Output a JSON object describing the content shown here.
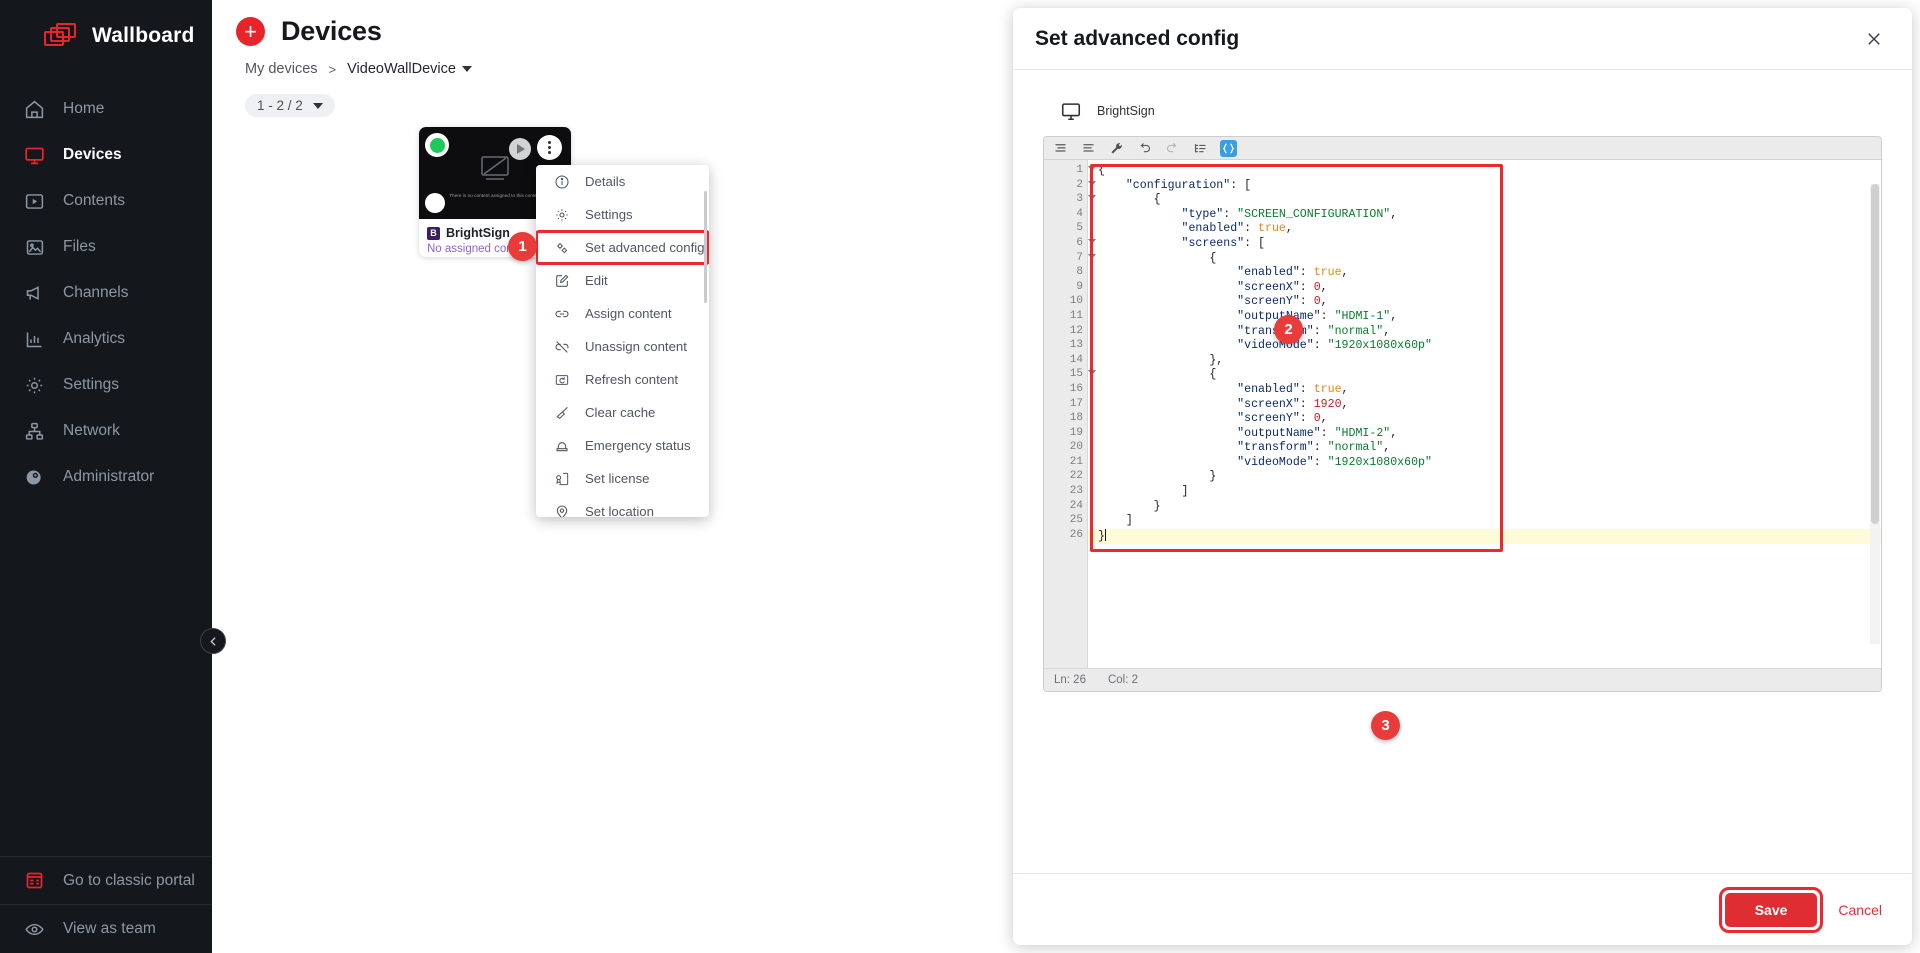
{
  "sidebar": {
    "brand": "Wallboard",
    "items": [
      {
        "label": "Home",
        "icon": "home-icon"
      },
      {
        "label": "Devices",
        "icon": "monitor-icon",
        "active": true
      },
      {
        "label": "Contents",
        "icon": "play-box-icon"
      },
      {
        "label": "Files",
        "icon": "image-icon"
      },
      {
        "label": "Channels",
        "icon": "megaphone-icon"
      },
      {
        "label": "Analytics",
        "icon": "bar-chart-icon"
      },
      {
        "label": "Settings",
        "icon": "gear-icon"
      },
      {
        "label": "Network",
        "icon": "network-icon"
      },
      {
        "label": "Administrator",
        "icon": "admin-icon"
      }
    ],
    "bottom": [
      {
        "label": "Go to classic portal",
        "icon": "classic-portal-icon"
      },
      {
        "label": "View as team",
        "icon": "eye-icon"
      }
    ],
    "collapse_icon": "chevron-left-icon"
  },
  "page": {
    "title": "Devices",
    "add_label": "+",
    "breadcrumb": {
      "root": "My devices",
      "separator": ">",
      "current": "VideoWallDevice"
    },
    "pager_label": "1 - 2 / 2"
  },
  "device_card": {
    "name": "BrightSign",
    "badge": "B",
    "status": "No assigned content",
    "thumb_message": "There is no content assigned to this content",
    "status_dot_color": "#1ec85a"
  },
  "context_menu": {
    "items": [
      {
        "label": "Details",
        "icon": "info-icon"
      },
      {
        "label": "Settings",
        "icon": "gear-icon"
      },
      {
        "label": "Set advanced config",
        "icon": "advanced-config-icon",
        "highlighted": true
      },
      {
        "label": "Edit",
        "icon": "edit-icon"
      },
      {
        "label": "Assign content",
        "icon": "link-icon"
      },
      {
        "label": "Unassign content",
        "icon": "unlink-icon"
      },
      {
        "label": "Refresh content",
        "icon": "refresh-icon"
      },
      {
        "label": "Clear cache",
        "icon": "broom-icon"
      },
      {
        "label": "Emergency status",
        "icon": "siren-icon"
      },
      {
        "label": "Set license",
        "icon": "license-icon"
      },
      {
        "label": "Set location",
        "icon": "location-icon"
      }
    ]
  },
  "annotations": [
    {
      "number": "1"
    },
    {
      "number": "2"
    },
    {
      "number": "3"
    }
  ],
  "modal": {
    "title": "Set advanced config",
    "close_icon": "close-icon",
    "device_name": "BrightSign",
    "device_icon": "monitor-icon",
    "toolbar": [
      {
        "icon": "compact-json-icon"
      },
      {
        "icon": "format-json-icon"
      },
      {
        "icon": "repair-wrench-icon"
      },
      {
        "icon": "undo-icon"
      },
      {
        "icon": "redo-icon",
        "disabled": true
      },
      {
        "icon": "tree-view-icon"
      },
      {
        "icon": "code-view-icon",
        "active": true
      }
    ],
    "editor": {
      "lines": [
        {
          "n": 1,
          "fold": true,
          "text": "{"
        },
        {
          "n": 2,
          "fold": true,
          "text": "    \"configuration\": ["
        },
        {
          "n": 3,
          "fold": true,
          "text": "        {"
        },
        {
          "n": 4,
          "fold": false,
          "text": "            \"type\": \"SCREEN_CONFIGURATION\","
        },
        {
          "n": 5,
          "fold": false,
          "text": "            \"enabled\": true,"
        },
        {
          "n": 6,
          "fold": true,
          "text": "            \"screens\": ["
        },
        {
          "n": 7,
          "fold": true,
          "text": "                {"
        },
        {
          "n": 8,
          "fold": false,
          "text": "                    \"enabled\": true,"
        },
        {
          "n": 9,
          "fold": false,
          "text": "                    \"screenX\": 0,"
        },
        {
          "n": 10,
          "fold": false,
          "text": "                    \"screenY\": 0,"
        },
        {
          "n": 11,
          "fold": false,
          "text": "                    \"outputName\": \"HDMI-1\","
        },
        {
          "n": 12,
          "fold": false,
          "text": "                    \"transform\": \"normal\","
        },
        {
          "n": 13,
          "fold": false,
          "text": "                    \"videoMode\": \"1920x1080x60p\""
        },
        {
          "n": 14,
          "fold": false,
          "text": "                },"
        },
        {
          "n": 15,
          "fold": true,
          "text": "                {"
        },
        {
          "n": 16,
          "fold": false,
          "text": "                    \"enabled\": true,"
        },
        {
          "n": 17,
          "fold": false,
          "text": "                    \"screenX\": 1920,"
        },
        {
          "n": 18,
          "fold": false,
          "text": "                    \"screenY\": 0,"
        },
        {
          "n": 19,
          "fold": false,
          "text": "                    \"outputName\": \"HDMI-2\","
        },
        {
          "n": 20,
          "fold": false,
          "text": "                    \"transform\": \"normal\","
        },
        {
          "n": 21,
          "fold": false,
          "text": "                    \"videoMode\": \"1920x1080x60p\""
        },
        {
          "n": 22,
          "fold": false,
          "text": "                }"
        },
        {
          "n": 23,
          "fold": false,
          "text": "            ]"
        },
        {
          "n": 24,
          "fold": false,
          "text": "        }"
        },
        {
          "n": 25,
          "fold": false,
          "text": "    ]"
        },
        {
          "n": 26,
          "fold": false,
          "text": "}",
          "current": true
        }
      ],
      "status_line": "Ln: 26",
      "status_col": "Col: 2"
    },
    "save_label": "Save",
    "cancel_label": "Cancel"
  },
  "colors": {
    "accent": "#e8242a",
    "sidebar_bg": "#14181c",
    "highlight": "#ea2a30",
    "status_green": "#1ec85a"
  }
}
